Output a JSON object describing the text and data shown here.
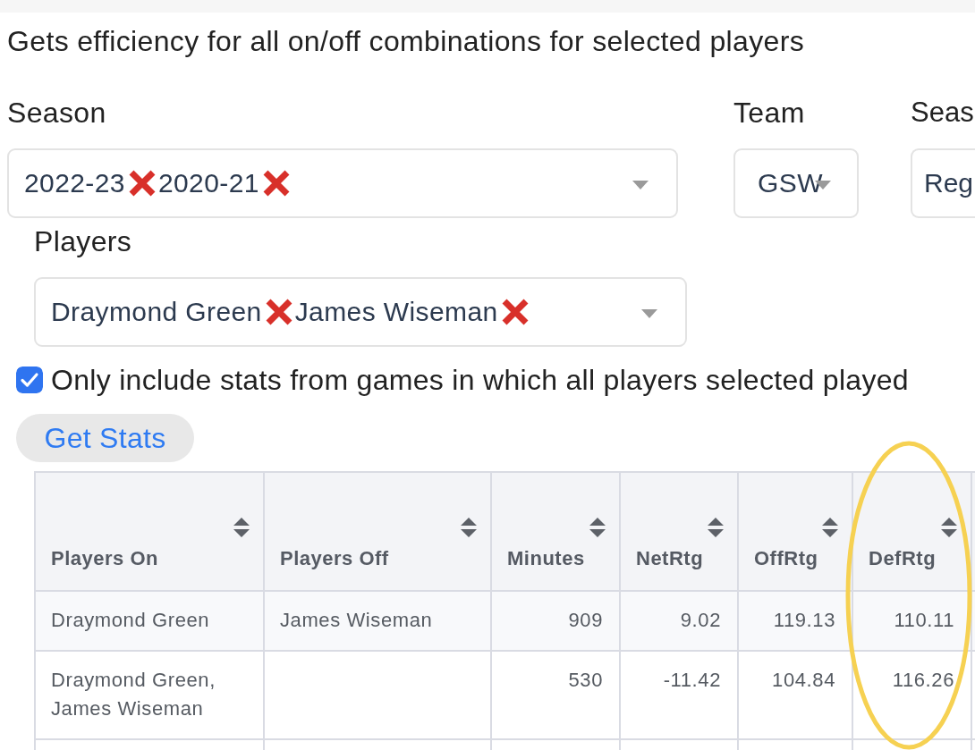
{
  "description": "Gets efficiency for all on/off combinations for selected players",
  "filters": {
    "season": {
      "label": "Season",
      "values": [
        "2022-23",
        "2020-21"
      ]
    },
    "team": {
      "label": "Team",
      "value": "GSW"
    },
    "season_type": {
      "label": "Seas",
      "value": "Reg"
    }
  },
  "players": {
    "label": "Players",
    "values": [
      "Draymond Green",
      "James Wiseman"
    ]
  },
  "only_common_games": {
    "label": "Only include stats from games in which all players selected played",
    "checked": true
  },
  "get_stats_button": "Get Stats",
  "table": {
    "columns": [
      {
        "label": "Players On",
        "kind": "text",
        "highlighted": false
      },
      {
        "label": "Players Off",
        "kind": "text",
        "highlighted": false
      },
      {
        "label": "Minutes",
        "kind": "number",
        "highlighted": false
      },
      {
        "label": "NetRtg",
        "kind": "number",
        "highlighted": false
      },
      {
        "label": "OffRtg",
        "kind": "number",
        "highlighted": false
      },
      {
        "label": "DefRtg",
        "kind": "number",
        "highlighted": true
      }
    ],
    "rows": [
      [
        "Draymond Green",
        "James Wiseman",
        "909",
        "9.02",
        "119.13",
        "110.11"
      ],
      [
        "Draymond Green, James Wiseman",
        null,
        "530",
        "-11.42",
        "104.84",
        "116.26"
      ]
    ]
  }
}
